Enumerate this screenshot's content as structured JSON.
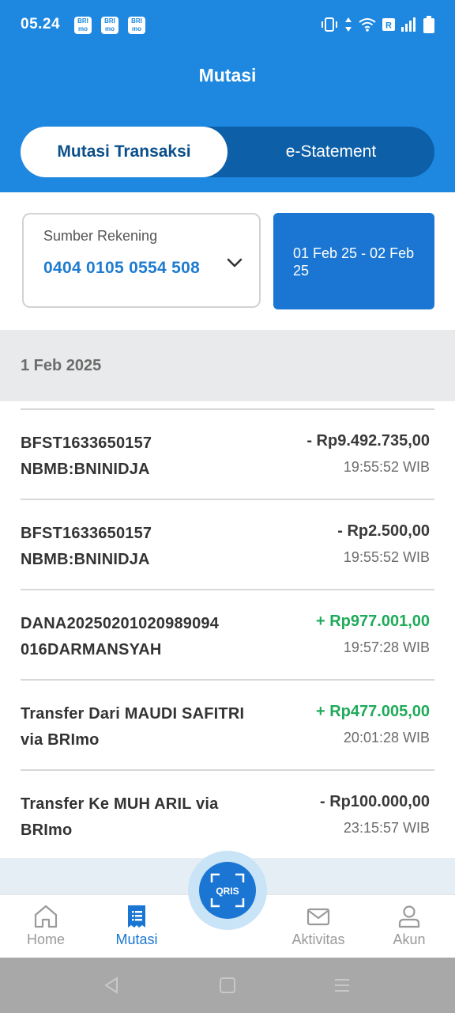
{
  "status_bar": {
    "time": "05.24",
    "notifications": [
      "BRI mo",
      "BRI mo",
      "BRI mo"
    ]
  },
  "header": {
    "title": "Mutasi"
  },
  "tabs": {
    "active": "Mutasi Transaksi",
    "inactive": "e-Statement"
  },
  "filter": {
    "account_label": "Sumber Rekening",
    "account_number": "0404 0105 0554 508",
    "date_range": "01 Feb 25 - 02 Feb 25"
  },
  "group": {
    "date": "1 Feb 2025"
  },
  "transactions": [
    {
      "desc": "BFST1633650157 NBMB:BNINIDJA",
      "amount": "- Rp9.492.735,00",
      "time": "19:55:52 WIB",
      "type": "debit"
    },
    {
      "desc": "BFST1633650157 NBMB:BNINIDJA",
      "amount": "- Rp2.500,00",
      "time": "19:55:52 WIB",
      "type": "debit"
    },
    {
      "desc": "DANA20250201020989094 016DARMANSYAH",
      "amount": "+ Rp977.001,00",
      "time": "19:57:28 WIB",
      "type": "credit"
    },
    {
      "desc": "Transfer Dari MAUDI SAFITRI via BRImo",
      "amount": "+ Rp477.005,00",
      "time": "20:01:28 WIB",
      "type": "credit"
    },
    {
      "desc": "Transfer Ke MUH ARIL via BRImo",
      "amount": "- Rp100.000,00",
      "time": "23:15:57 WIB",
      "type": "debit"
    }
  ],
  "bottom_nav": {
    "home": "Home",
    "mutasi": "Mutasi",
    "aktivitas": "Aktivitas",
    "akun": "Akun",
    "qris": "QRIS"
  },
  "colors": {
    "primary": "#1e88e0",
    "dark_primary": "#0d5fa8",
    "credit": "#1faa5a",
    "debit": "#3a3a3a"
  }
}
